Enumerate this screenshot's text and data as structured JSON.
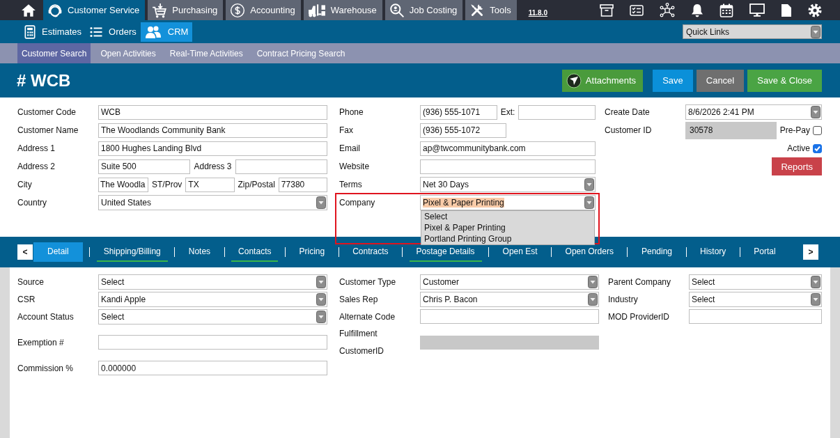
{
  "top_nav": {
    "modules": [
      {
        "label": "Customer Service",
        "selected": true
      },
      {
        "label": "Purchasing",
        "selected": false
      },
      {
        "label": "Accounting",
        "selected": false
      },
      {
        "label": "Warehouse",
        "selected": false
      },
      {
        "label": "Job Costing",
        "selected": false
      },
      {
        "label": "Tools",
        "selected": false
      }
    ],
    "version": "11.8.0"
  },
  "sub_nav": {
    "items": [
      {
        "label": "Estimates",
        "selected": false
      },
      {
        "label": "Orders",
        "selected": false
      },
      {
        "label": "CRM",
        "selected": true
      }
    ],
    "quick_links": "Quick Links"
  },
  "section_nav": [
    {
      "label": "Customer Search",
      "selected": true
    },
    {
      "label": "Open Activities",
      "selected": false
    },
    {
      "label": "Real-Time Activities",
      "selected": false
    },
    {
      "label": "Contract Pricing Search",
      "selected": false
    }
  ],
  "record": {
    "title": "# WCB",
    "buttons": [
      {
        "label": "Attachments",
        "kind": "attach"
      },
      {
        "label": "Save",
        "kind": "primary"
      },
      {
        "label": "Cancel",
        "kind": "neutral"
      },
      {
        "label": "Save & Close",
        "kind": "success"
      }
    ]
  },
  "main_form": {
    "columns": [
      {
        "rows": [
          {
            "label": "Customer Code",
            "controls": [
              {
                "kind": "input",
                "value": "WCB"
              }
            ]
          },
          {
            "label": "Customer Name",
            "controls": [
              {
                "kind": "input",
                "value": "The Woodlands Community Bank"
              }
            ]
          },
          {
            "label": "Address 1",
            "controls": [
              {
                "kind": "input",
                "value": "1800 Hughes Landing Blvd"
              }
            ]
          },
          {
            "label": "Address 2",
            "controls": [
              {
                "kind": "input",
                "value": "Suite 500"
              },
              {
                "kind": "text",
                "text": "Address 3"
              },
              {
                "kind": "input"
              }
            ]
          },
          {
            "label": "City",
            "controls": [
              {
                "kind": "input",
                "value": "The Woodla"
              },
              {
                "kind": "text",
                "text": "ST/Prov"
              },
              {
                "kind": "input",
                "value": "TX"
              },
              {
                "kind": "text",
                "text": "Zip/Postal"
              },
              {
                "kind": "input",
                "value": "77380"
              }
            ]
          },
          {
            "label": "Country",
            "controls": [
              {
                "kind": "select",
                "value": "United States"
              }
            ]
          }
        ]
      },
      {
        "rows": [
          {
            "label": "Phone",
            "controls": [
              {
                "kind": "input",
                "value": "(936) 555-1071"
              },
              {
                "kind": "text",
                "text": "Ext:"
              },
              {
                "kind": "input"
              }
            ]
          },
          {
            "label": "Fax",
            "controls": [
              {
                "kind": "input",
                "value": "(936) 555-1072"
              }
            ]
          },
          {
            "label": "Email",
            "controls": [
              {
                "kind": "input",
                "value": "ap@twcommunitybank.com"
              }
            ]
          },
          {
            "label": "Website",
            "controls": [
              {
                "kind": "input"
              }
            ]
          },
          {
            "label": "Terms",
            "controls": [
              {
                "kind": "select",
                "value": "Net 30 Days"
              }
            ]
          },
          {
            "label": "Company",
            "outlined": true,
            "controls": [
              {
                "kind": "select",
                "value": "Pixel & Paper Printing",
                "highlighted": true,
                "open": true,
                "options": [
                  "Select",
                  "Pixel & Paper Printing",
                  "Portland Printing Group"
                ]
              }
            ]
          }
        ]
      },
      {
        "rows": [
          {
            "label": "Create Date",
            "controls": [
              {
                "kind": "select",
                "value": "8/6/2026 2:41 PM"
              }
            ]
          },
          {
            "label": "Customer ID",
            "controls": [
              {
                "kind": "readonly",
                "value": "30578"
              },
              {
                "kind": "checkbox",
                "label": "Pre-Pay",
                "checked": false
              }
            ]
          },
          {
            "controls": [
              {
                "kind": "checkbox",
                "label": "Active",
                "checked": true
              }
            ]
          },
          {
            "controls": [
              {
                "kind": "button",
                "label": "Reports"
              }
            ]
          }
        ]
      }
    ]
  },
  "detail_tabs": {
    "prev": "<",
    "next": ">",
    "tabs": [
      {
        "label": "Detail",
        "selected": true,
        "underlined": false
      },
      {
        "label": "Shipping/Billing",
        "selected": false,
        "underlined": true
      },
      {
        "label": "Notes",
        "selected": false,
        "underlined": false
      },
      {
        "label": "Contacts",
        "selected": false,
        "underlined": true
      },
      {
        "label": "Pricing",
        "selected": false,
        "underlined": false
      },
      {
        "label": "Contracts",
        "selected": false,
        "underlined": false
      },
      {
        "label": "Postage Details",
        "selected": false,
        "underlined": true
      },
      {
        "label": "Open Est",
        "selected": false,
        "underlined": false
      },
      {
        "label": "Open Orders",
        "selected": false,
        "underlined": false
      },
      {
        "label": "Pending",
        "selected": false,
        "underlined": false
      },
      {
        "label": "History",
        "selected": false,
        "underlined": false
      },
      {
        "label": "Portal",
        "selected": false,
        "underlined": false
      }
    ]
  },
  "detail_form": {
    "columns": [
      {
        "rows": [
          {
            "label": "Source",
            "controls": [
              {
                "kind": "select",
                "value": "Select"
              }
            ]
          },
          {
            "label": "CSR",
            "controls": [
              {
                "kind": "select",
                "value": "Kandi Apple"
              }
            ]
          },
          {
            "label": "Account Status",
            "controls": [
              {
                "kind": "select",
                "value": "Select"
              }
            ]
          },
          {
            "label": "Exemption #",
            "controls": [
              {
                "kind": "input"
              }
            ]
          },
          {
            "label": "Commission %",
            "controls": [
              {
                "kind": "input",
                "value": "0.000000"
              }
            ]
          }
        ]
      },
      {
        "rows": [
          {
            "label": "Customer Type",
            "controls": [
              {
                "kind": "select",
                "value": "Customer"
              }
            ]
          },
          {
            "label": "Sales Rep",
            "controls": [
              {
                "kind": "select",
                "value": "Chris P. Bacon"
              }
            ]
          },
          {
            "label": "Alternate Code",
            "controls": [
              {
                "kind": "input"
              }
            ]
          },
          {
            "labels": [
              "Fulfillment",
              "CustomerID"
            ],
            "controls": [
              {
                "kind": "readonly"
              }
            ]
          }
        ]
      },
      {
        "rows": [
          {
            "label": "Parent Company",
            "controls": [
              {
                "kind": "select",
                "value": "Select"
              }
            ]
          },
          {
            "label": "Industry",
            "controls": [
              {
                "kind": "select",
                "value": "Select"
              }
            ]
          },
          {
            "label": "MOD ProviderID",
            "controls": [
              {
                "kind": "input"
              }
            ]
          }
        ]
      }
    ]
  }
}
